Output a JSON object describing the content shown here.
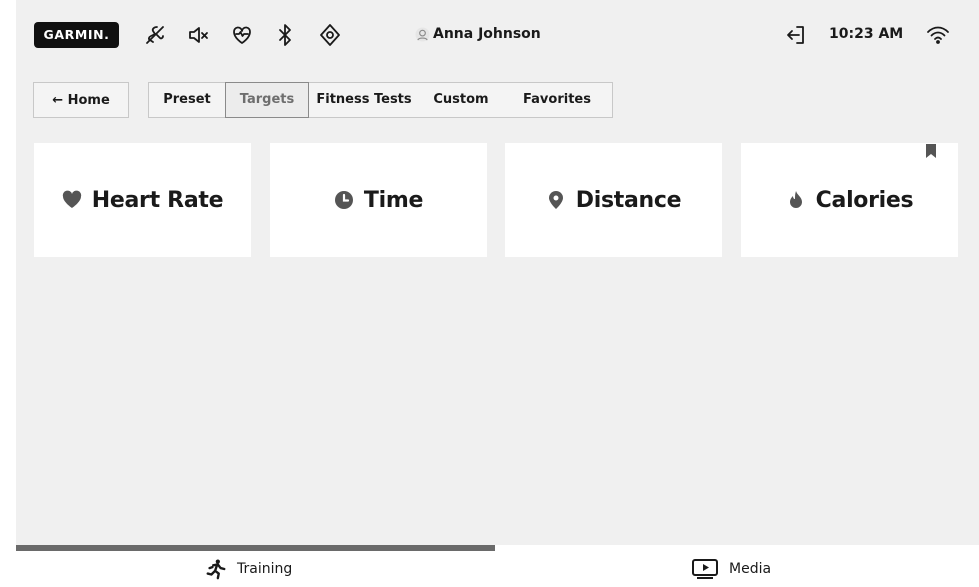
{
  "status_bar": {
    "brand": "GARMIN.",
    "icons": [
      "no-motion-icon",
      "volume-off-icon",
      "heart-monitor-icon",
      "bluetooth-icon",
      "sensor-icon"
    ],
    "user_name": "Anna Johnson",
    "time": "10:23 AM"
  },
  "nav": {
    "home_label": "← Home",
    "tabs": [
      {
        "label": "Preset",
        "active": false
      },
      {
        "label": "Targets",
        "active": true
      },
      {
        "label": "Fitness Tests",
        "active": false
      },
      {
        "label": "Custom",
        "active": false
      },
      {
        "label": "Favorites",
        "active": false
      }
    ]
  },
  "cards": [
    {
      "label": "Heart Rate",
      "icon": "heart-icon"
    },
    {
      "label": "Time",
      "icon": "clock-icon"
    },
    {
      "label": "Distance",
      "icon": "location-pin-icon"
    },
    {
      "label": "Calories",
      "icon": "flame-icon",
      "bookmarked": true
    }
  ],
  "bottom_nav": {
    "tabs": [
      {
        "label": "Training",
        "icon": "runner-icon",
        "active": true
      },
      {
        "label": "Media",
        "icon": "play-screen-icon",
        "active": false
      }
    ]
  },
  "colors": {
    "background": "#f0f0f0",
    "card": "#ffffff",
    "text": "#1a1a1a",
    "indicator": "#6a6a6a",
    "brand_bg": "#111111"
  }
}
